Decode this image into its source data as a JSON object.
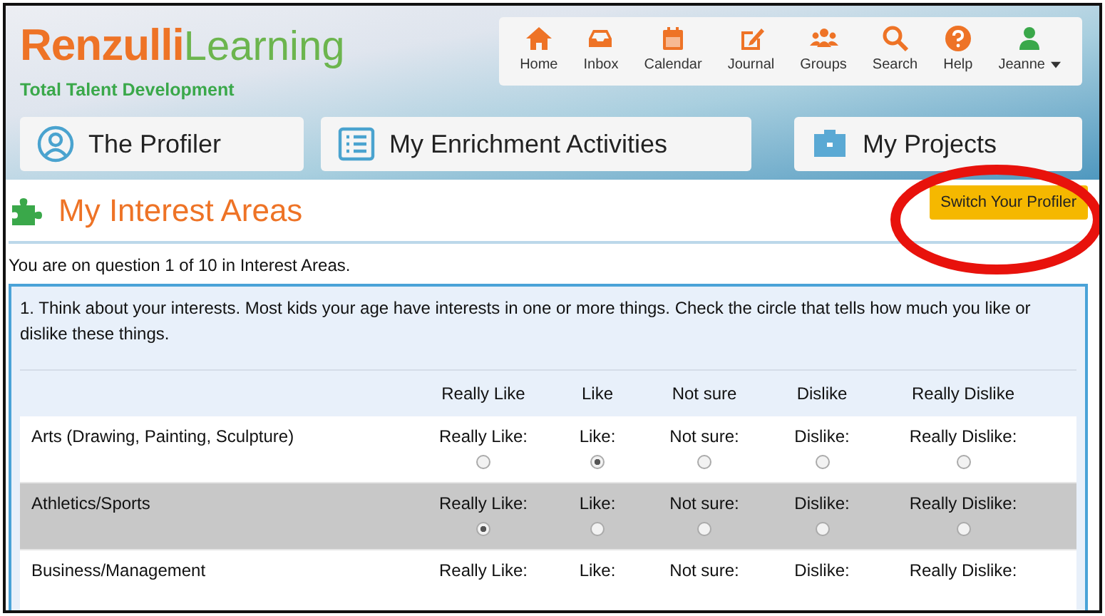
{
  "header": {
    "logo": {
      "brand": "Renzulli",
      "suffix": "Learning",
      "tagline": "Total Talent Development"
    },
    "nav": [
      {
        "label": "Home",
        "kind": "home"
      },
      {
        "label": "Inbox",
        "kind": "inbox"
      },
      {
        "label": "Calendar",
        "kind": "calendar"
      },
      {
        "label": "Journal",
        "kind": "journal"
      },
      {
        "label": "Groups",
        "kind": "groups"
      },
      {
        "label": "Search",
        "kind": "search"
      },
      {
        "label": "Help",
        "kind": "help"
      }
    ],
    "user": {
      "name": "Jeanne"
    },
    "tabs": [
      {
        "label": "The Profiler",
        "kind": "profile"
      },
      {
        "label": "My Enrichment Activities",
        "kind": "list"
      },
      {
        "label": "My Projects",
        "kind": "briefcase"
      }
    ]
  },
  "page": {
    "title": "My Interest Areas",
    "switch_button": "Switch Your Profiler",
    "progress": "You are on question 1 of 10 in Interest Areas."
  },
  "question": {
    "text": "1. Think about your interests. Most kids your age have interests in one or more things. Check the circle that tells how much you like or dislike these things.",
    "columns": [
      "Really Like",
      "Like",
      "Not sure",
      "Dislike",
      "Really Dislike"
    ],
    "rows": [
      {
        "label": "Arts (Drawing, Painting, Sculpture)",
        "highlighted": false,
        "options": [
          {
            "label": "Really Like:",
            "selected": false
          },
          {
            "label": "Like:",
            "selected": true
          },
          {
            "label": "Not sure:",
            "selected": false
          },
          {
            "label": "Dislike:",
            "selected": false
          },
          {
            "label": "Really Dislike:",
            "selected": false
          }
        ]
      },
      {
        "label": "Athletics/Sports",
        "highlighted": true,
        "options": [
          {
            "label": "Really Like:",
            "selected": true
          },
          {
            "label": "Like:",
            "selected": false
          },
          {
            "label": "Not sure:",
            "selected": false
          },
          {
            "label": "Dislike:",
            "selected": false
          },
          {
            "label": "Really Dislike:",
            "selected": false
          }
        ]
      },
      {
        "label": "Business/Management",
        "highlighted": false,
        "options": [
          {
            "label": "Really Like:"
          },
          {
            "label": "Like:"
          },
          {
            "label": "Not sure:"
          },
          {
            "label": "Dislike:"
          },
          {
            "label": "Really Dislike:"
          }
        ]
      }
    ]
  }
}
